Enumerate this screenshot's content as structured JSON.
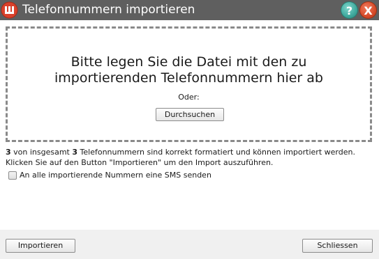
{
  "dialog": {
    "title": "Telefonnummern importieren",
    "help_symbol": "?",
    "close_symbol": "X"
  },
  "dropzone": {
    "line1": "Bitte legen Sie die Datei mit den zu",
    "line2": "importierenden Telefonnummern hier ab",
    "or_label": "Oder:",
    "browse_label": "Durchsuchen"
  },
  "status": {
    "valid_count": "3",
    "text_a": " von insgesamt ",
    "total_count": "3",
    "text_b": " Telefonnummern sind korrekt formatiert und können importiert werden.",
    "line2": "Klicken Sie auf den Button \"Importieren\" um den Import auszuführen."
  },
  "sms_option": {
    "label": "An alle importierende Nummern eine SMS senden",
    "checked": false
  },
  "footer": {
    "import_label": "Importieren",
    "close_label": "Schliessen"
  },
  "icons": {
    "app": "app-logo-icon",
    "help": "help-icon",
    "close": "close-icon"
  },
  "colors": {
    "titlebar": "#5f5f5f",
    "help_button": "#3fa99d",
    "close_button": "#d64b2a",
    "logo": "#d9412b"
  }
}
